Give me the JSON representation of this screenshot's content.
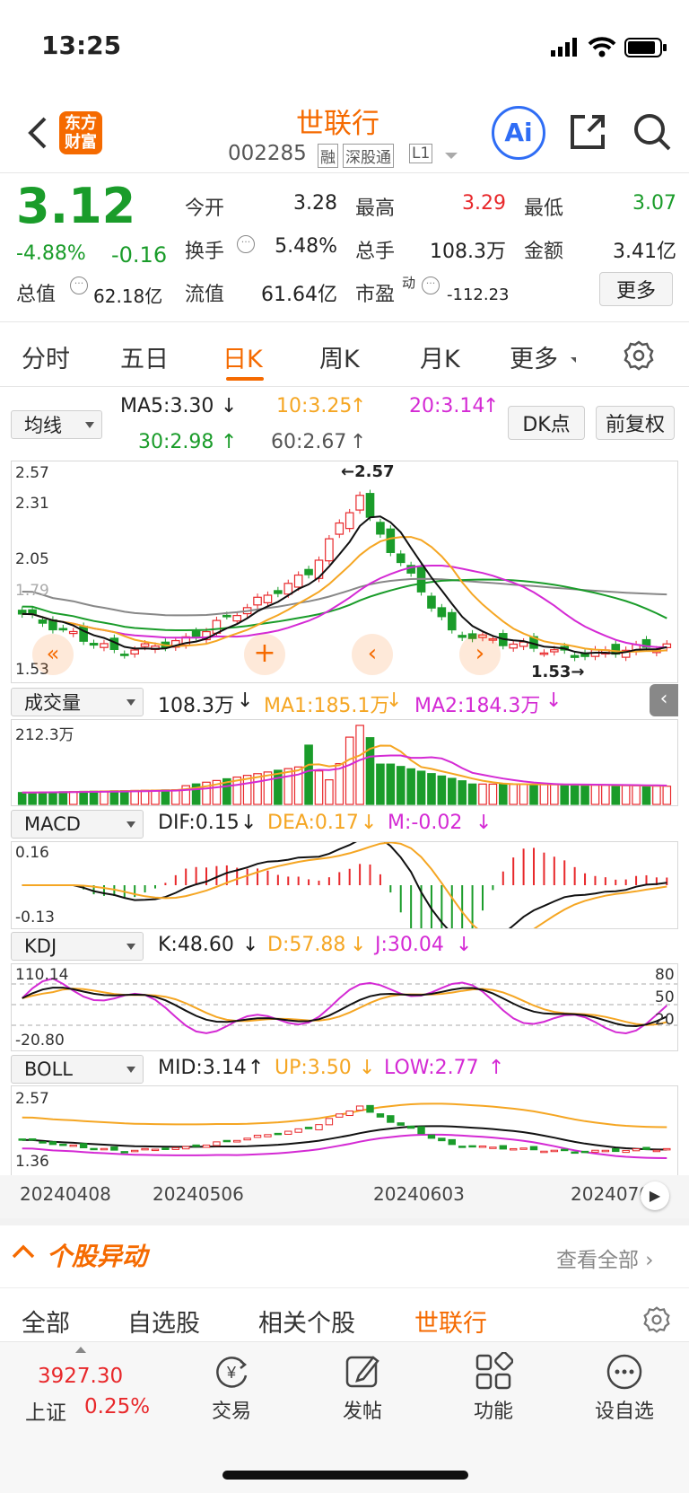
{
  "status_bar": {
    "time": "13:25"
  },
  "header": {
    "logo_text": "东方财富",
    "stock_name": "世联行",
    "stock_code": "002285",
    "tags": [
      "融",
      "深股通",
      "L1"
    ],
    "ai_label": "Ai"
  },
  "quote": {
    "price": "3.12",
    "change_pct": "-4.88%",
    "change": "-0.16",
    "items": [
      {
        "label": "今开",
        "value": "3.28"
      },
      {
        "label": "最高",
        "value": "3.29"
      },
      {
        "label": "最低",
        "value": "3.07"
      },
      {
        "label": "换手",
        "value": "5.48%"
      },
      {
        "label": "总手",
        "value": "108.3万"
      },
      {
        "label": "金额",
        "value": "3.41亿"
      },
      {
        "label": "总值",
        "value": "62.18亿"
      },
      {
        "label": "流值",
        "value": "61.64亿"
      },
      {
        "label": "市盈",
        "label_sup": "动",
        "value": "-112.23"
      }
    ],
    "more_label": "更多"
  },
  "period_tabs": [
    "分时",
    "五日",
    "日K",
    "周K",
    "月K",
    "更多"
  ],
  "active_tab": "日K",
  "kline": {
    "selector": "均线",
    "ma5": "MA5:3.30",
    "ma10": "10:3.25",
    "ma20": "20:3.14",
    "ma30": "30:2.98",
    "ma60": "60:2.67",
    "dk_label": "DK点",
    "fq_label": "前复权",
    "y_max": "2.57",
    "y_2": "2.31",
    "y_3": "2.05",
    "y_4": "1.79",
    "y_min": "1.53",
    "peak_label": "2.57",
    "low_label": "1.53"
  },
  "volume": {
    "selector": "成交量",
    "value": "108.3万",
    "ma1": "MA1:185.1万",
    "ma2": "MA2:184.3万",
    "y_max": "212.3万"
  },
  "macd": {
    "selector": "MACD",
    "dif": "DIF:0.15",
    "dea": "DEA:0.17",
    "m": "M:-0.02",
    "y_max": "0.16",
    "y_min": "-0.13"
  },
  "kdj": {
    "selector": "KDJ",
    "k": "K:48.60",
    "d": "D:57.88",
    "j": "J:30.04",
    "y_max": "110.14",
    "y_min": "-20.80",
    "r80": "80",
    "r50": "50",
    "r20": "20"
  },
  "boll": {
    "selector": "BOLL",
    "mid": "MID:3.14",
    "up": "UP:3.50",
    "low": "LOW:2.77",
    "y_max": "2.57",
    "y_min": "1.36"
  },
  "dates": [
    "20240408",
    "20240506",
    "20240603",
    "2024070"
  ],
  "section": {
    "title": "个股异动",
    "view_all": "查看全部"
  },
  "filter_tabs": [
    "全部",
    "自选股",
    "相关个股",
    "世联行"
  ],
  "bottom_nav": {
    "index_value": "3927.30",
    "index_name": "上证",
    "index_change": "0.25%",
    "items": [
      {
        "label": "交易",
        "icon": "yen-exchange-icon"
      },
      {
        "label": "发帖",
        "icon": "edit-icon"
      },
      {
        "label": "功能",
        "icon": "grid-icon"
      },
      {
        "label": "设自选",
        "icon": "more-dots-icon"
      }
    ]
  },
  "colors": {
    "brand": "#f56a00",
    "up": "#e8282b",
    "down": "#1a9c2a",
    "ma10": "#f5a623",
    "ma20": "#d42ad4"
  }
}
